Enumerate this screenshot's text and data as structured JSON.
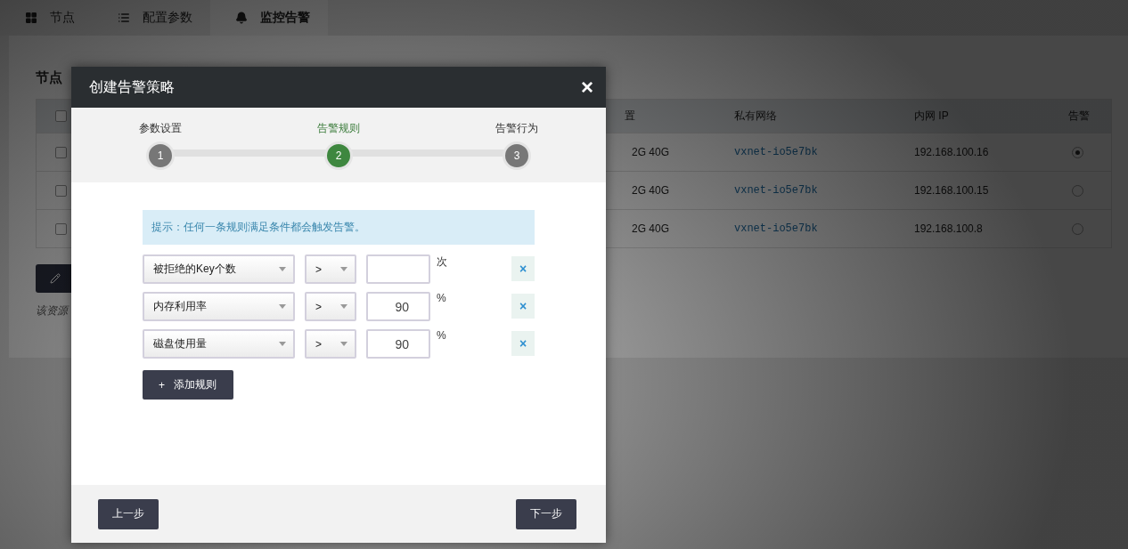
{
  "tabs": [
    {
      "label": "节点",
      "kind": "grid",
      "selected": false
    },
    {
      "label": "配置参数",
      "kind": "list",
      "selected": false
    },
    {
      "label": "监控告警",
      "kind": "bell",
      "selected": true
    }
  ],
  "panel": {
    "title": "节点",
    "header_checkbox": {
      "checked": false
    },
    "columns": [
      "置",
      "私有网络",
      "内网 IP",
      "告警"
    ],
    "rows": [
      {
        "checked": false,
        "column_3": "2G 40G",
        "network": "vxnet-io5e7bk",
        "ip": "192.168.100.16",
        "alert_selected": true
      },
      {
        "checked": false,
        "column_3": "2G 40G",
        "network": "vxnet-io5e7bk",
        "ip": "192.168.100.15",
        "alert_selected": false
      },
      {
        "checked": false,
        "column_3": "2G 40G",
        "network": "vxnet-io5e7bk",
        "ip": "192.168.100.8",
        "alert_selected": false
      }
    ],
    "note": "该资源"
  },
  "dialog": {
    "title": "创建告警策略",
    "close": "×",
    "steps": [
      {
        "label": "参数设置",
        "number": "1",
        "selected": false
      },
      {
        "label": "告警规则",
        "number": "2",
        "selected": true
      },
      {
        "label": "告警行为",
        "number": "3",
        "selected": false
      }
    ],
    "tip": "提示：任何一条规则满足条件都会触发告警。",
    "rules": [
      {
        "metric": "被拒绝的Key个数",
        "operator": ">",
        "unit": "次",
        "remove": "×"
      },
      {
        "metric": "内存利用率",
        "operator": ">",
        "value": "90",
        "unit": "%",
        "remove": "×"
      },
      {
        "metric": "磁盘使用量",
        "operator": ">",
        "value": "90",
        "unit": "%",
        "remove": "×"
      }
    ],
    "add_button": {
      "icon": "+",
      "label": "添加规则"
    },
    "buttons": [
      "上一步",
      "下一步"
    ]
  }
}
